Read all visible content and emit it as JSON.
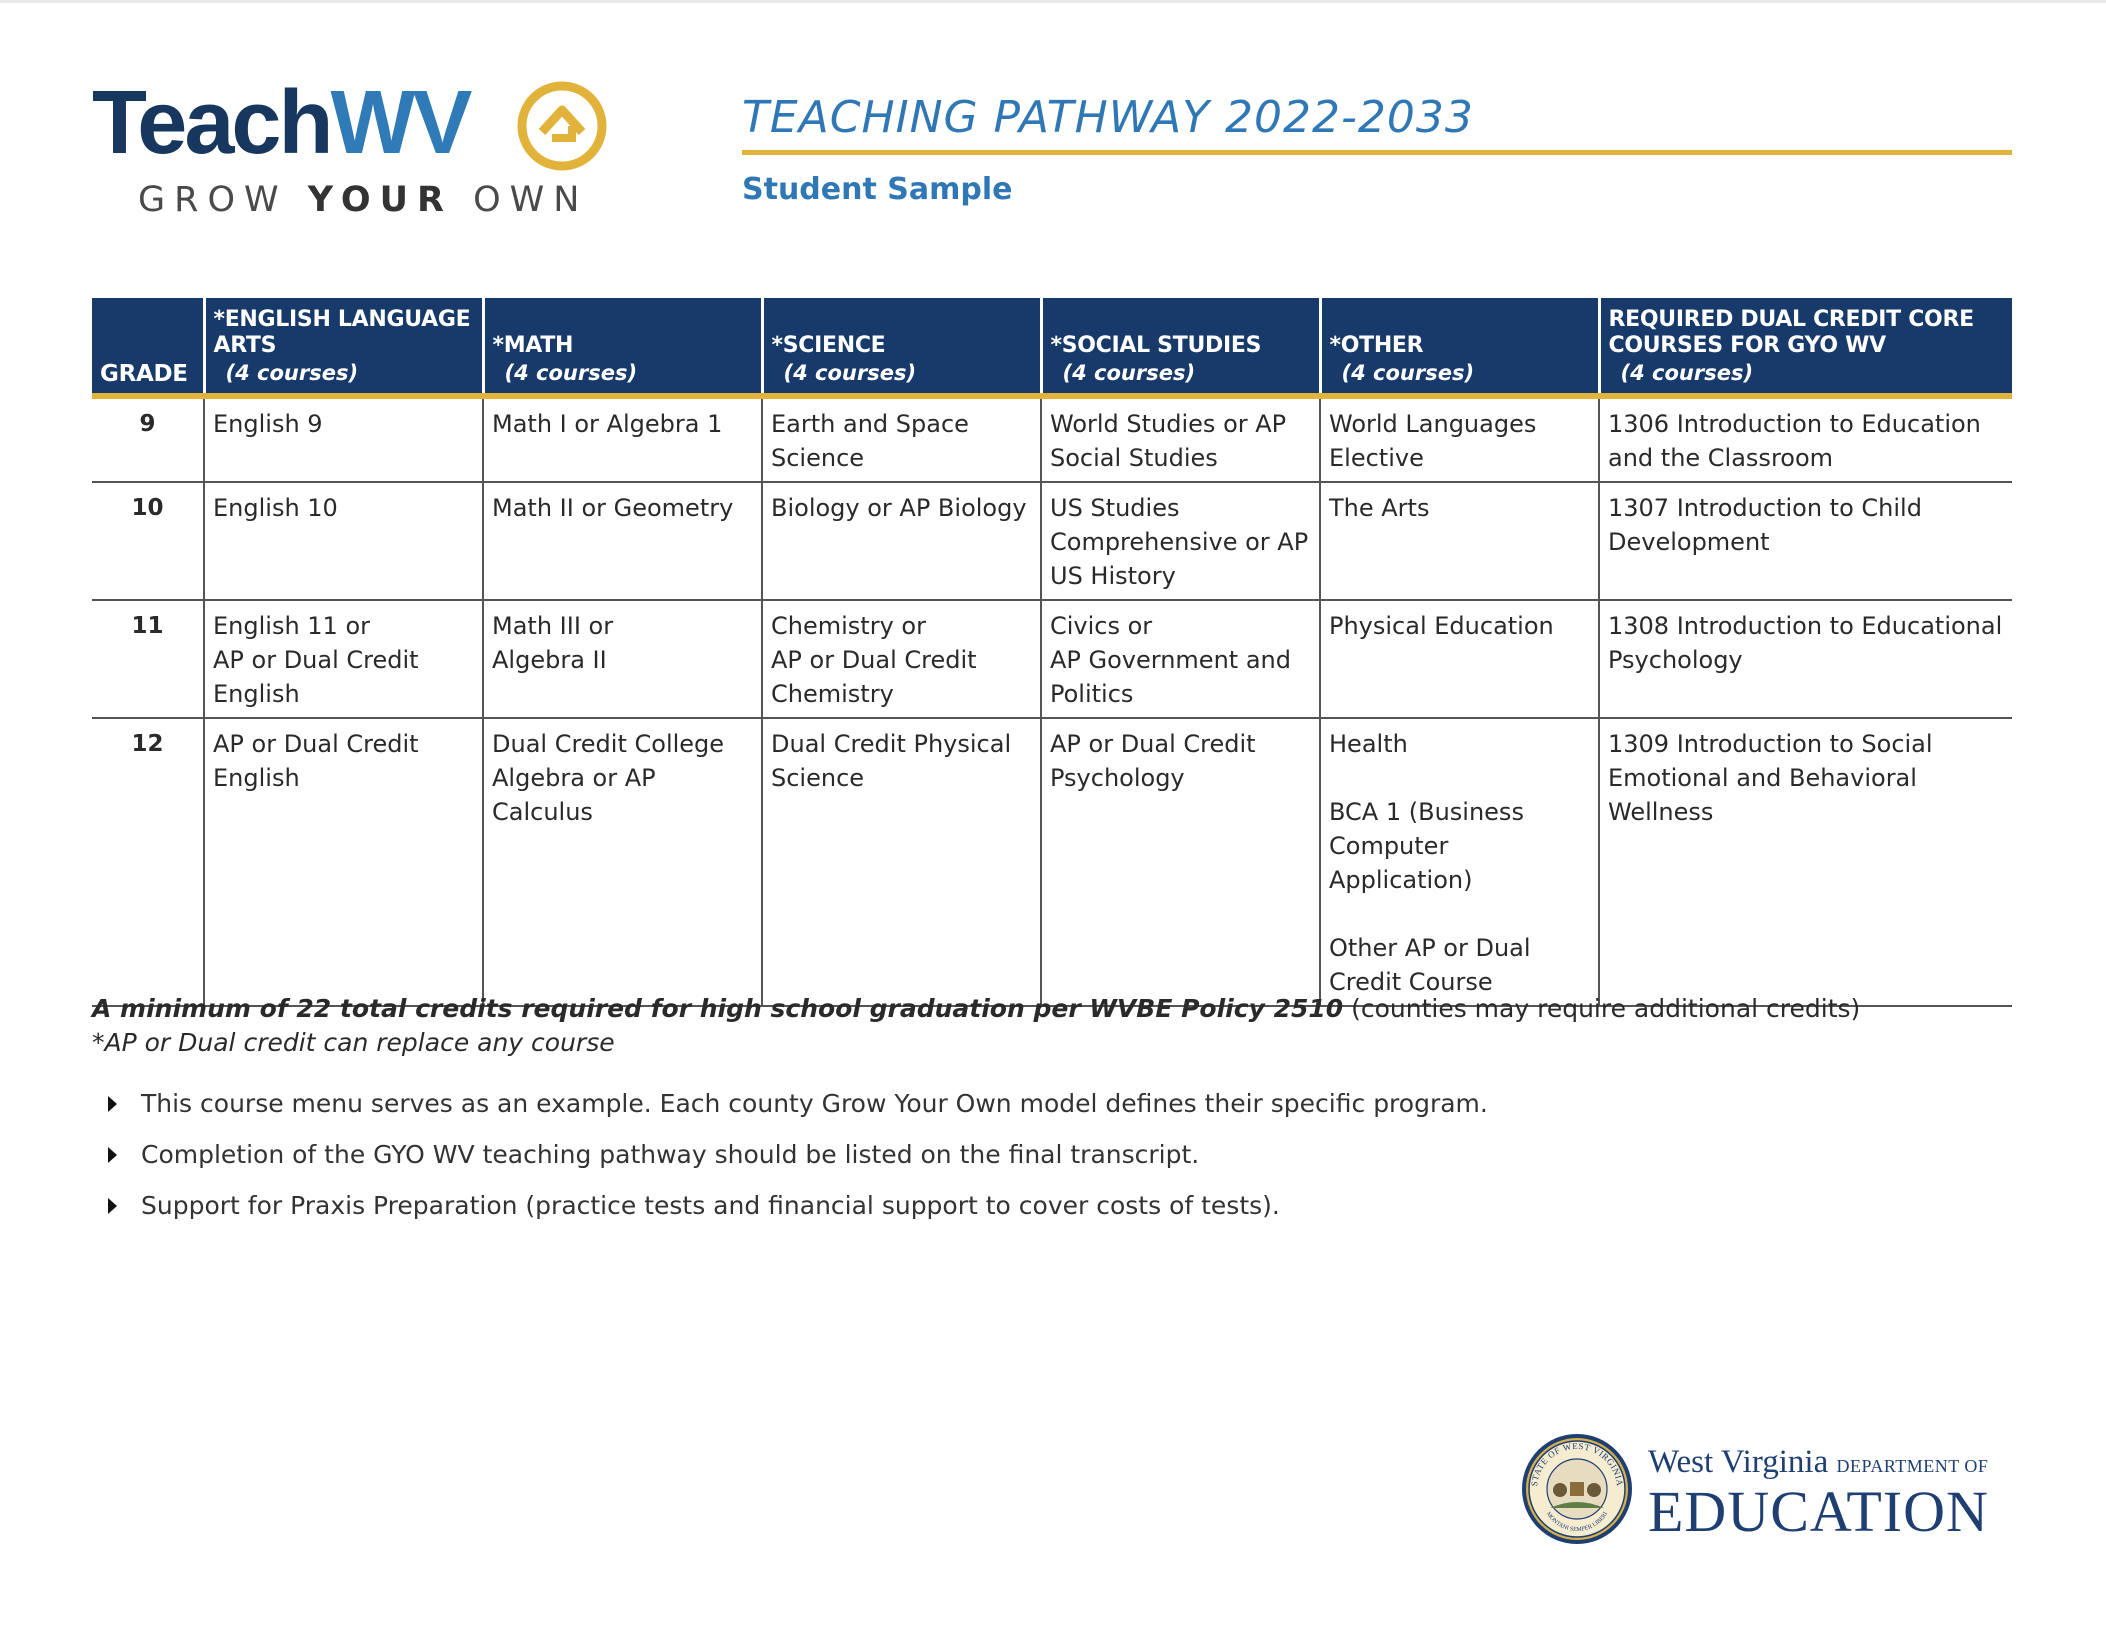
{
  "logo": {
    "word_teach": "Teach",
    "word_wv": "WV",
    "tag_grow": "GROW",
    "tag_your": "YOUR",
    "tag_own": "OWN",
    "icon": "teachwv-mark-icon",
    "colors": {
      "navy": "#17375f",
      "blue": "#2e7bb8",
      "gold": "#e1b33a"
    }
  },
  "header": {
    "title": "TEACHING PATHWAY 2022-2033",
    "subtitle": "Student Sample"
  },
  "table": {
    "columns": [
      {
        "title": "GRADE",
        "sub": ""
      },
      {
        "title": "*ENGLISH LANGUAGE ARTS",
        "sub": "(4 courses)"
      },
      {
        "title": "*MATH",
        "sub": "(4 courses)"
      },
      {
        "title": "*SCIENCE",
        "sub": "(4 courses)"
      },
      {
        "title": "*SOCIAL STUDIES",
        "sub": "(4 courses)"
      },
      {
        "title": "*OTHER",
        "sub": "(4 courses)"
      },
      {
        "title": "REQUIRED DUAL CREDIT CORE COURSES FOR GYO WV",
        "sub": "(4 courses)"
      }
    ],
    "rows": [
      {
        "grade": "9",
        "ela": "English 9",
        "math": "Math I or Algebra 1",
        "science": "Earth and Space Science",
        "social": "World Studies or AP Social Studies",
        "other": "World Languages Elective",
        "core": "1306 Introduction to Education and the Classroom"
      },
      {
        "grade": "10",
        "ela": "English 10",
        "math": "Math II or Geometry",
        "science": "Biology or AP Biology",
        "social": "US Studies Comprehensive or AP US History",
        "other": "The Arts",
        "core": "1307 Introduction to Child Development"
      },
      {
        "grade": "11",
        "ela_1": "English 11 or",
        "ela_2": "AP or Dual Credit English",
        "math_1": "Math III or",
        "math_2": "Algebra II",
        "science_1": "Chemistry or",
        "science_2": "AP or Dual Credit Chemistry",
        "social_1": "Civics or",
        "social_2": "AP Government and Politics",
        "other": "Physical Education",
        "core": "1308 Introduction to Educational Psychology"
      },
      {
        "grade": "12",
        "ela": "AP or Dual Credit English",
        "math": "Dual Credit College Algebra or AP Calculus",
        "science": "Dual Credit Physical Science",
        "social": "AP or Dual Credit Psychology",
        "other_1": "Health",
        "other_2": "BCA 1 (Business Computer Application)",
        "other_3": "Other AP or Dual Credit Course",
        "core": "1309 Introduction to Social Emotional and Behavioral Wellness"
      }
    ]
  },
  "notes": {
    "bold_text": "A minimum of 22 total credits required for high school graduation per WVBE Policy 2510",
    "rest_text": " (counties may require additional credits)",
    "ap_note": "*AP or Dual credit can replace any course",
    "bullets": [
      "This course menu serves as an example. Each county Grow Your Own model defines their specific program.",
      "Completion of the GYO WV teaching pathway should be listed on the final transcript.",
      "Support for Praxis Preparation (practice tests and financial support to cover costs of tests)."
    ]
  },
  "wvde": {
    "line1": "West Virginia",
    "line1_small": "DEPARTMENT OF",
    "line2": "EDUCATION",
    "seal_icon": "state-seal-icon",
    "seal_text": "STATE OF WEST VIRGINIA",
    "motto": "MONTANI SEMPER LIBERI"
  }
}
